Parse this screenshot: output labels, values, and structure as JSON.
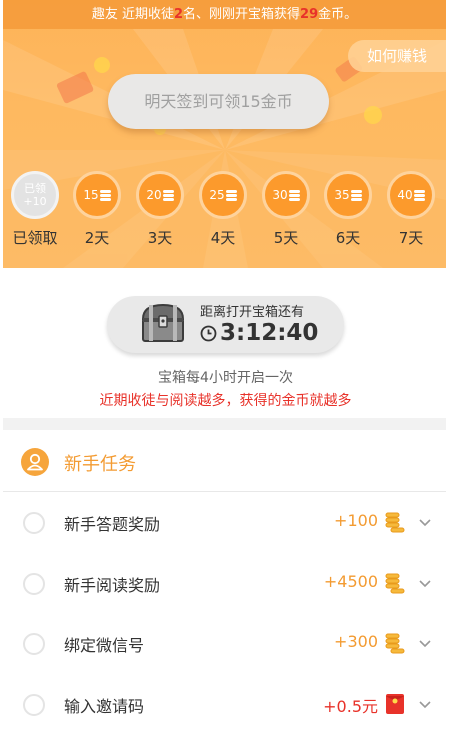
{
  "ticker": {
    "prefix": "趣友 近期收徒",
    "disciples": "2",
    "middle": "名、刚刚开宝箱获得",
    "coins": "29",
    "suffix": "金币。"
  },
  "header": {
    "earn_button": "如何赚钱",
    "signin_button": "明天签到可领15金币"
  },
  "checkin": {
    "claimed_badge": {
      "line1": "已领",
      "line2": "+10"
    },
    "days": [
      {
        "amount": "",
        "label": "已领取",
        "claimed": true
      },
      {
        "amount": "15",
        "label": "2天",
        "claimed": false
      },
      {
        "amount": "20",
        "label": "3天",
        "claimed": false
      },
      {
        "amount": "25",
        "label": "4天",
        "claimed": false
      },
      {
        "amount": "30",
        "label": "5天",
        "claimed": false
      },
      {
        "amount": "35",
        "label": "6天",
        "claimed": false
      },
      {
        "amount": "40",
        "label": "7天",
        "claimed": false
      }
    ]
  },
  "chest": {
    "caption": "距离打开宝箱还有",
    "countdown": "3:12:40",
    "note": "宝箱每4小时开启一次",
    "tip": "近期收徒与阅读越多，获得的金币就越多"
  },
  "tasks": {
    "title": "新手任务",
    "items": [
      {
        "label": "新手答题奖励",
        "reward": "+100",
        "reward_icon": "coin-stack-icon"
      },
      {
        "label": "新手阅读奖励",
        "reward": "+4500",
        "reward_icon": "coin-stack-icon"
      },
      {
        "label": "绑定微信号",
        "reward": "+300",
        "reward_icon": "coin-stack-icon"
      },
      {
        "label": "输入邀请码",
        "reward": "+0.5元",
        "reward_icon": "red-envelope-icon"
      }
    ]
  },
  "colors": {
    "accent": "#f39b32",
    "highlight": "#e8322a",
    "banner": "#feb960",
    "coin": "#fc9a2c"
  }
}
